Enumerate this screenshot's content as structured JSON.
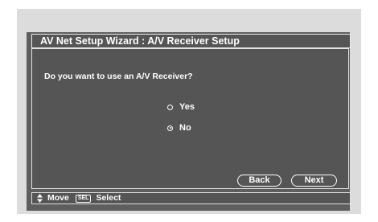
{
  "dialog": {
    "title": "AV Net Setup Wizard : A/V Receiver Setup",
    "question": "Do you want to use an A/V Receiver?",
    "options": [
      {
        "label": "Yes",
        "selected": false
      },
      {
        "label": "No",
        "selected": true
      }
    ],
    "back_label": "Back",
    "next_label": "Next"
  },
  "footer": {
    "move_label": "Move",
    "sel_key": "SEL",
    "select_label": "Select"
  },
  "icons": {
    "updown": "up-down-arrow-icon",
    "radio": "radio-button-icon"
  }
}
